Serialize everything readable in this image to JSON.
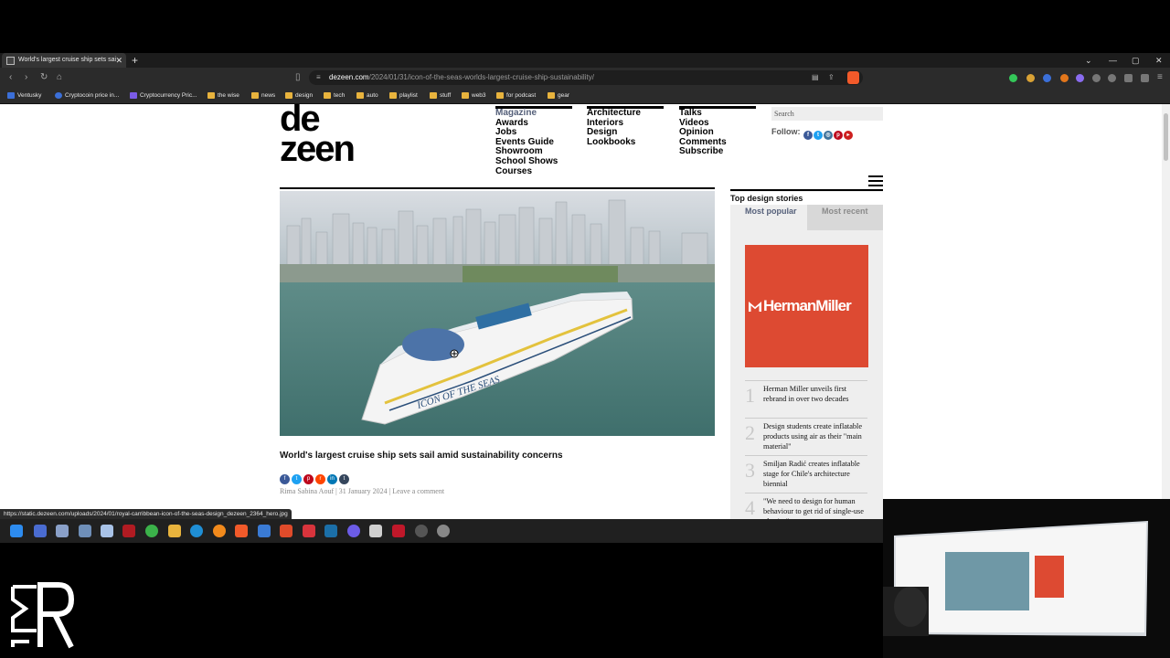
{
  "browser": {
    "tab_title": "World's largest cruise ship sets sai",
    "new_tab": "+",
    "url_host": "dezeen.com",
    "url_path": "/2024/01/31/icon-of-the-seas-worlds-largest-cruise-ship-sustainability/",
    "bookmarks": [
      "Ventusky",
      "Cryptocoin price in...",
      "Cryptocurrency Pric...",
      "the wise",
      "news",
      "design",
      "tech",
      "auto",
      "playlist",
      "stuff",
      "web3",
      "for podcast",
      "gear"
    ],
    "status_url": "https://static.dezeen.com/uploads/2024/01/royal-carribbean-icon-of-the-seas-design_dezeen_2364_hero.jpg"
  },
  "site": {
    "logo_line1": "de",
    "logo_line2": "zeen",
    "nav_col1": [
      "Magazine",
      "Awards",
      "Jobs",
      "Events Guide",
      "Showroom",
      "School Shows",
      "Courses"
    ],
    "nav_col2": [
      "Architecture",
      "Interiors",
      "Design",
      "Lookbooks"
    ],
    "nav_col3": [
      "Talks",
      "Videos",
      "Opinion",
      "Comments",
      "Subscribe"
    ],
    "search_placeholder": "Search",
    "follow_label": "Follow:"
  },
  "article": {
    "hero_ship_name": "ICON OF THE SEAS",
    "headline": "World's largest cruise ship sets sail amid sustainability concerns",
    "author": "Rima Sabina Aouf",
    "date": "31 January 2024",
    "comment_link": "Leave a comment"
  },
  "sidebar": {
    "title": "Top design stories",
    "tab_popular": "Most popular",
    "tab_recent": "Most recent",
    "ad_brand": "HermanMiller",
    "stories": [
      {
        "num": "1",
        "title": "Herman Miller unveils first rebrand in over two decades"
      },
      {
        "num": "2",
        "title": "Design students create inflatable products using air as their \"main material\""
      },
      {
        "num": "3",
        "title": "Smiljan Radić creates inflatable stage for Chile's architecture biennial"
      },
      {
        "num": "4",
        "title": "\"We need to design for human behaviour to get rid of single-use plastics\""
      }
    ]
  },
  "colors": {
    "accent_nav": "#55607a",
    "ad_red": "#dd4a32"
  }
}
